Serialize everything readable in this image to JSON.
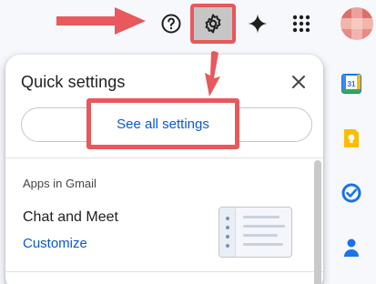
{
  "topbar": {
    "icons": [
      "help-icon",
      "settings-gear-icon",
      "gemini-sparkle-icon",
      "apps-grid-icon"
    ],
    "avatar": "user-avatar"
  },
  "quick_settings": {
    "title": "Quick settings",
    "see_all_label": "See all settings",
    "apps_section": {
      "heading": "Apps in Gmail",
      "item_label": "Chat and Meet",
      "action_label": "Customize"
    }
  },
  "side_panel": {
    "icons": [
      "calendar-icon",
      "keep-icon",
      "tasks-icon",
      "contacts-icon"
    ],
    "calendar_day": "31"
  },
  "annotation_color": "#e8585c",
  "accent_color": "#0b57d0"
}
